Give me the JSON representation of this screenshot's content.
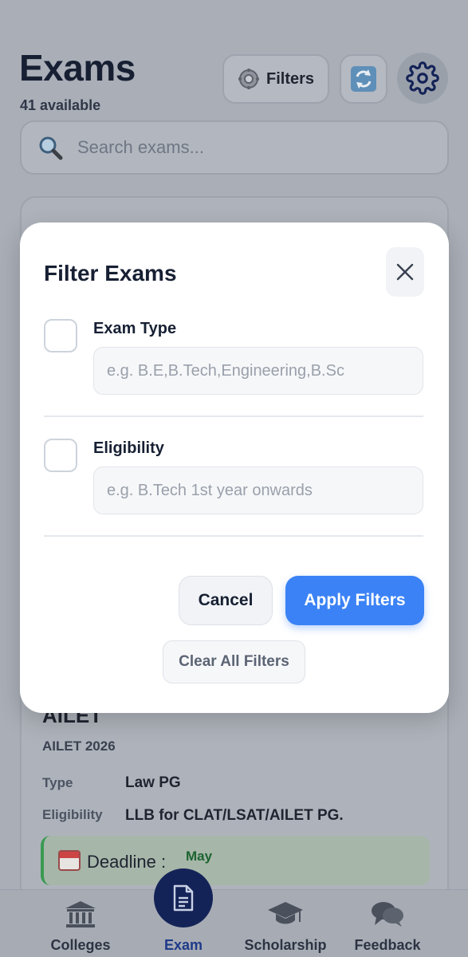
{
  "header": {
    "title": "Exams",
    "count_text": "41 available",
    "filters_label": "Filters"
  },
  "search": {
    "placeholder": "Search exams..."
  },
  "card": {
    "title": "AILET",
    "subtitle": "AILET  2026",
    "type_label": "Type",
    "type_value": "Law PG",
    "eligibility_label": "Eligibility",
    "eligibility_value": "LLB for CLAT/LSAT/AILET PG.",
    "deadline_label": "Deadline :",
    "deadline_month": "May"
  },
  "modal": {
    "title": "Filter Exams",
    "fields": [
      {
        "label": "Exam Type",
        "placeholder": "e.g. B.E,B.Tech,Engineering,B.Sc",
        "value": ""
      },
      {
        "label": "Eligibility",
        "placeholder": "e.g. B.Tech 1st year onwards",
        "value": ""
      }
    ],
    "cancel_label": "Cancel",
    "apply_label": "Apply Filters",
    "clear_label": "Clear All Filters"
  },
  "nav": {
    "items": [
      {
        "label": "Colleges",
        "icon": "bank-icon"
      },
      {
        "label": "Exam",
        "icon": "document-icon"
      },
      {
        "label": "Scholarship",
        "icon": "graduation-cap-icon"
      },
      {
        "label": "Feedback",
        "icon": "chat-bubbles-icon"
      }
    ],
    "active": "Exam"
  },
  "colors": {
    "accent": "#3b82f6",
    "nav_active": "#142357",
    "deadline_green": "#1d6430"
  }
}
